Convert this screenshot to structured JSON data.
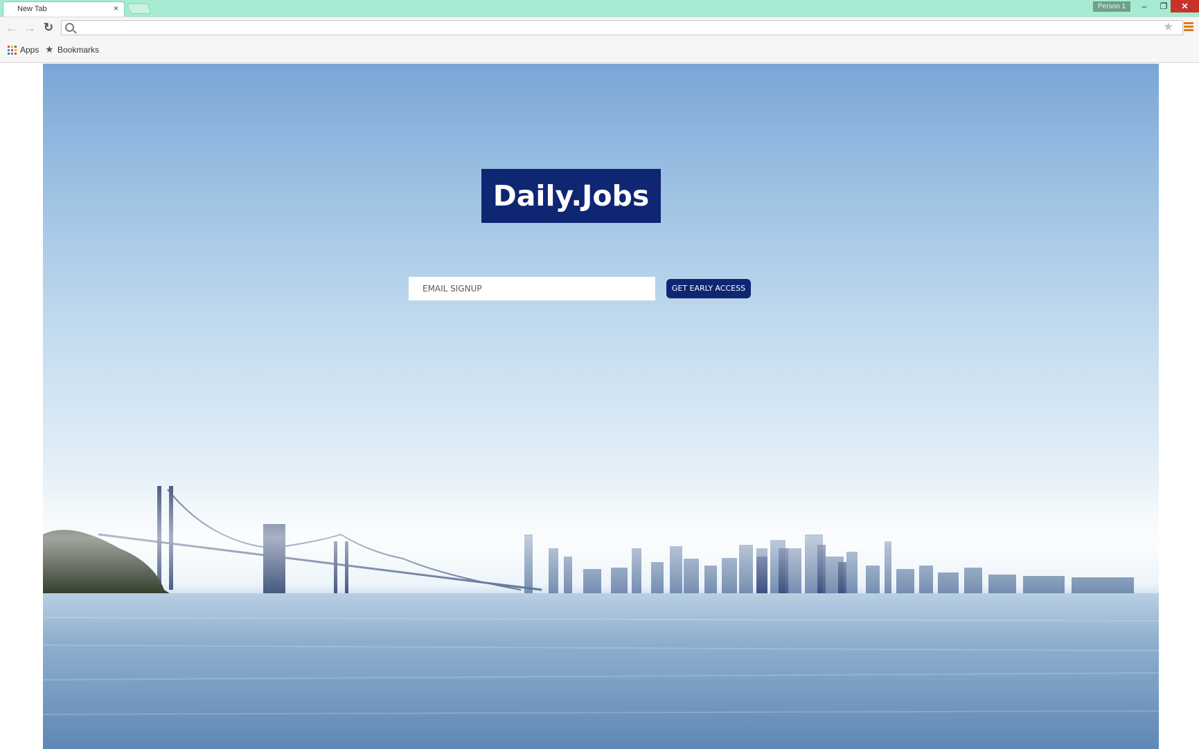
{
  "browser": {
    "tab_title": "New Tab",
    "tab_close_glyph": "×",
    "profile_label": "Person 1",
    "window_controls": {
      "minimize": "–",
      "maximize": "❐",
      "close": "✕"
    },
    "omnibox_value": "",
    "icons": [
      "back-arrow-icon",
      "forward-arrow-icon",
      "reload-icon",
      "search-icon",
      "star-icon",
      "menu-icon",
      "apps-icon",
      "bookmark-star-icon"
    ]
  },
  "bookmarks_bar": {
    "apps_label": "Apps",
    "bookmarks_label": "Bookmarks"
  },
  "page": {
    "logo_text": "Daily.Jobs",
    "email_placeholder": "EMAIL SIGNUP",
    "cta_label": "GET EARLY ACCESS",
    "colors": {
      "brand_navy": "#0f2673",
      "titlebar_mint": "#a6ebd1",
      "close_red": "#c9312b",
      "menu_orange": "#e07b1a"
    }
  }
}
